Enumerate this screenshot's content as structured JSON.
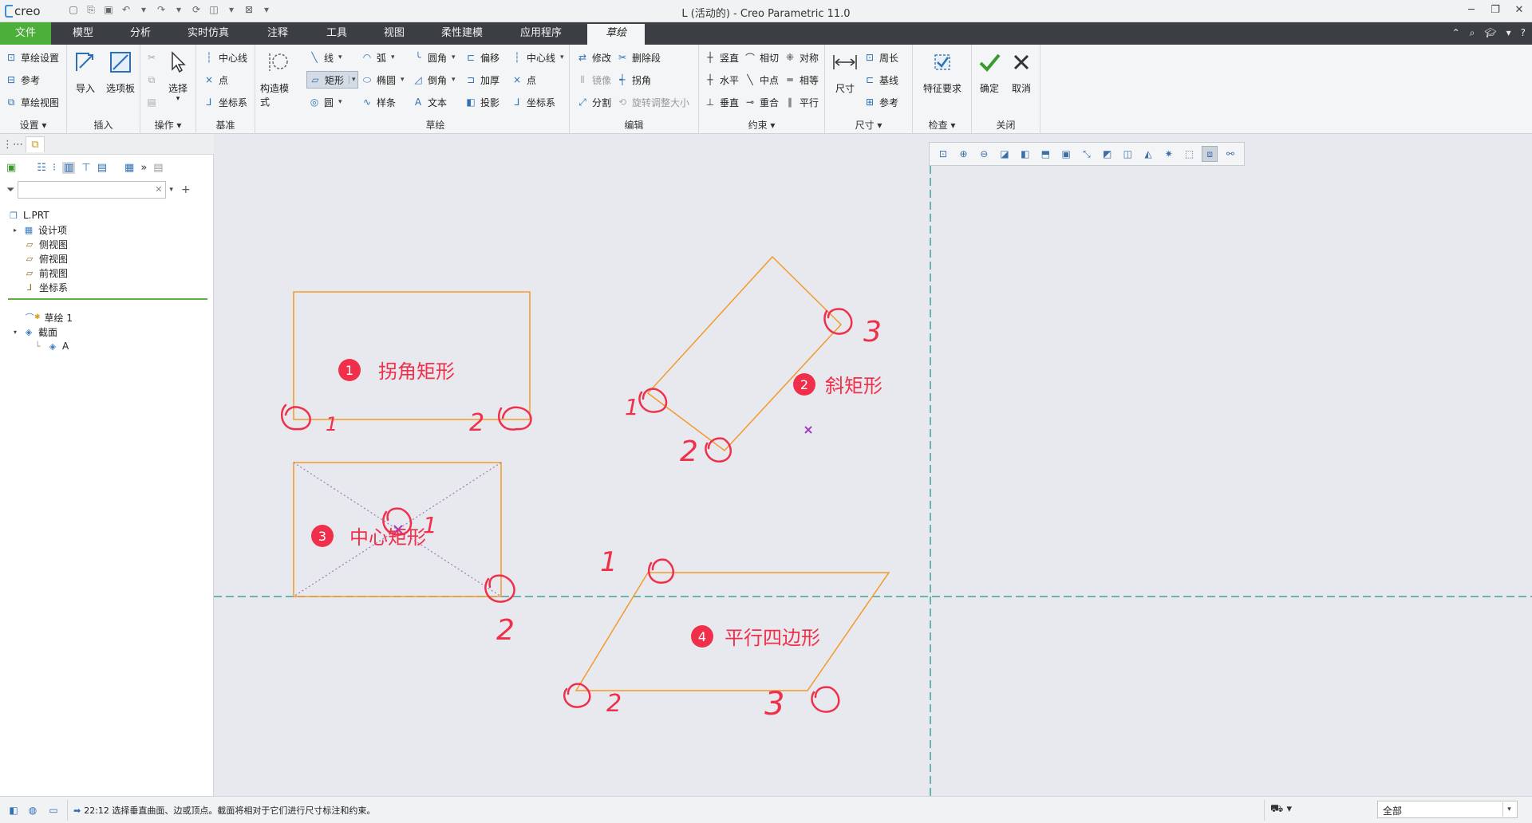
{
  "app": {
    "logo": "creo",
    "title": "L (活动的) - Creo Parametric 11.0"
  },
  "tabs": [
    "文件",
    "模型",
    "分析",
    "实时仿真",
    "注释",
    "工具",
    "视图",
    "柔性建模",
    "应用程序",
    "草绘"
  ],
  "active_tab": "草绘",
  "ribbon": {
    "settings": {
      "label": "设置",
      "items": [
        "草绘设置",
        "参考",
        "草绘视图"
      ]
    },
    "insert": {
      "label": "插入",
      "items": [
        "导入",
        "选项板"
      ]
    },
    "operations": {
      "label": "操作",
      "items": [
        "选择"
      ]
    },
    "datum": {
      "label": "基准",
      "items": [
        "中心线",
        "点",
        "坐标系"
      ]
    },
    "construction": {
      "label": "构造模式"
    },
    "sketch": {
      "label": "草绘",
      "col1": [
        "线",
        "矩形",
        "圆"
      ],
      "col2": [
        "弧",
        "椭圆",
        "样条"
      ],
      "col3": [
        "圆角",
        "倒角",
        "文本"
      ],
      "col4": [
        "偏移",
        "加厚",
        "投影"
      ],
      "col5": [
        "中心线",
        "点",
        "坐标系"
      ]
    },
    "edit": {
      "label": "编辑",
      "col1": [
        "修改",
        "镜像",
        "分割"
      ],
      "col2": [
        "删除段",
        "拐角",
        "旋转调整大小"
      ]
    },
    "constrain": {
      "label": "约束",
      "col1": [
        "竖直",
        "水平",
        "垂直"
      ],
      "col2": [
        "相切",
        "中点",
        "重合"
      ],
      "col3": [
        "对称",
        "相等",
        "平行"
      ]
    },
    "dimension": {
      "label": "尺寸",
      "big": "尺寸",
      "items": [
        "周长",
        "基线",
        "参考"
      ]
    },
    "inspect": {
      "label": "检查",
      "big": "特征要求"
    },
    "close": {
      "label": "关闭",
      "ok": "确定",
      "cancel": "取消"
    }
  },
  "tree": {
    "search_placeholder": "",
    "items": [
      {
        "label": "L.PRT"
      },
      {
        "label": "设计项"
      },
      {
        "label": "侧视图"
      },
      {
        "label": "俯视图"
      },
      {
        "label": "前视图"
      },
      {
        "label": "坐标系"
      },
      {
        "label": "草绘 1"
      },
      {
        "label": "截面"
      },
      {
        "label": "A"
      }
    ]
  },
  "annotations": [
    {
      "num": "1",
      "text": "拐角矩形"
    },
    {
      "num": "2",
      "text": "斜矩形"
    },
    {
      "num": "3",
      "text": "中心矩形"
    },
    {
      "num": "4",
      "text": "平行四边形"
    }
  ],
  "handwritten": [
    "1",
    "2",
    "1",
    "2",
    "3",
    "1",
    "2",
    "1",
    "2",
    "3"
  ],
  "colors": {
    "sketch_line": "#f39a2a",
    "annotation_red": "#f0304a",
    "centerline": "#3aa59a",
    "tab_file": "#4caf3a"
  },
  "status": {
    "message": "22:12 选择垂直曲面、边或顶点。截面将相对于它们进行尺寸标注和约束。",
    "filter_value": "全部"
  }
}
